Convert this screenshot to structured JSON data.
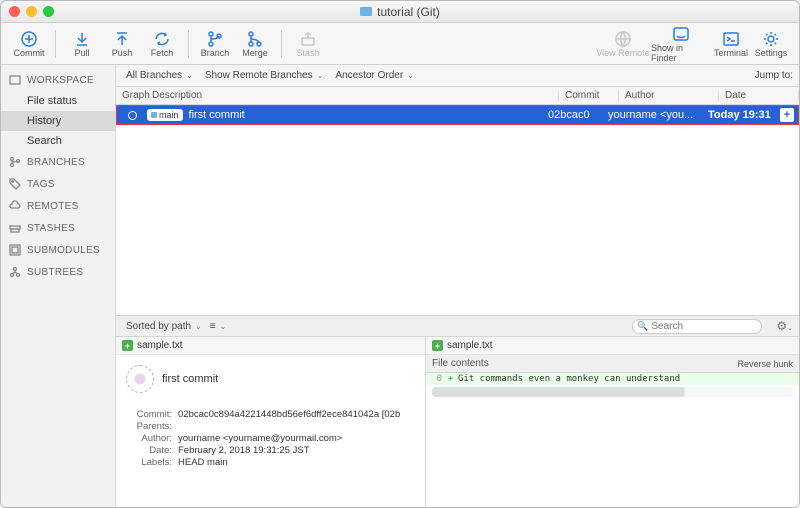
{
  "window": {
    "title": "tutorial (Git)"
  },
  "toolbar": {
    "commit": "Commit",
    "pull": "Pull",
    "push": "Push",
    "fetch": "Fetch",
    "branch": "Branch",
    "merge": "Merge",
    "stash": "Stash",
    "view_remote": "View Remote",
    "show_in_finder": "Show in Finder",
    "terminal": "Terminal",
    "settings": "Settings"
  },
  "sidebar": {
    "workspace": "WORKSPACE",
    "file_status": "File status",
    "history": "History",
    "search": "Search",
    "branches": "BRANCHES",
    "tags": "TAGS",
    "remotes": "REMOTES",
    "stashes": "STASHES",
    "submodules": "SUBMODULES",
    "subtrees": "SUBTREES"
  },
  "filters": {
    "all_branches": "All Branches",
    "show_remote": "Show Remote Branches",
    "ancestor": "Ancestor Order",
    "jump_to": "Jump to:"
  },
  "columns": {
    "graph": "Graph",
    "description": "Description",
    "commit": "Commit",
    "author": "Author",
    "date": "Date"
  },
  "row": {
    "branch": "main",
    "message": "first commit",
    "hash": "02bcac0",
    "author": "yourname <you...",
    "date": "Today 19:31"
  },
  "detailbar": {
    "sorted": "Sorted by path",
    "search_ph": "Search"
  },
  "file": {
    "name": "sample.txt"
  },
  "commit": {
    "message": "first commit",
    "hash": "02bcac0c894a4221448bd56ef6dff2ece841042a [02b",
    "parents": "",
    "author": "yourname <yourname@yourmail.com>",
    "date": "February 2, 2018 19:31:25 JST",
    "labels": "HEAD main",
    "k_commit": "Commit:",
    "k_parents": "Parents:",
    "k_author": "Author:",
    "k_date": "Date:",
    "k_labels": "Labels:"
  },
  "diff": {
    "file": "sample.txt",
    "header": "File contents",
    "reverse": "Reverse hunk",
    "line_no": "0",
    "line": "Git commands even a monkey can understand"
  }
}
